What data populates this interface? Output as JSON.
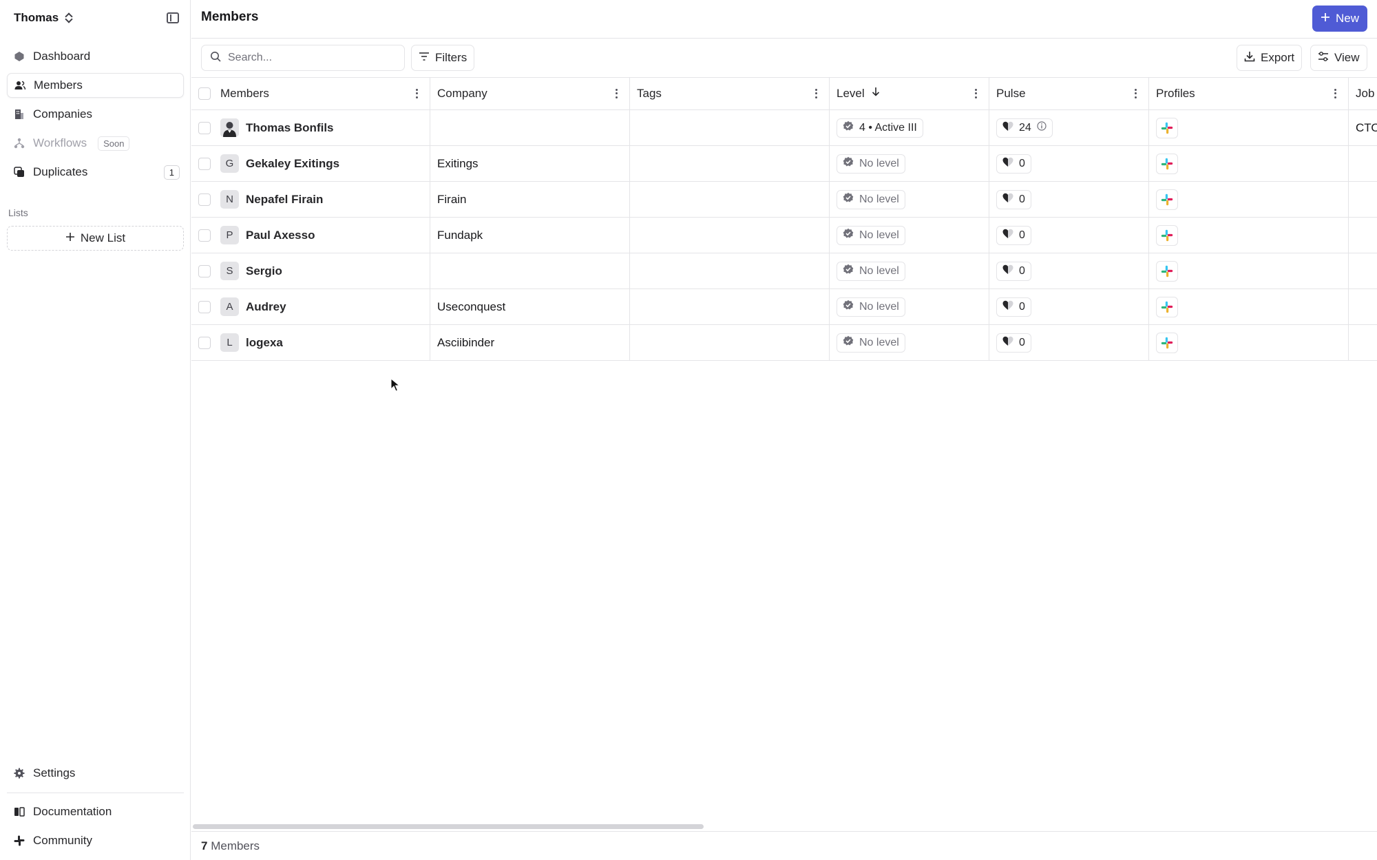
{
  "sidebar": {
    "workspace": "Thomas",
    "nav": [
      {
        "label": "Dashboard",
        "icon": "dashboard-icon"
      },
      {
        "label": "Members",
        "icon": "members-icon",
        "active": true
      },
      {
        "label": "Companies",
        "icon": "building-icon"
      },
      {
        "label": "Workflows",
        "icon": "workflow-icon",
        "badge": "Soon",
        "disabled": true
      },
      {
        "label": "Duplicates",
        "icon": "duplicates-icon",
        "count": "1"
      }
    ],
    "lists_label": "Lists",
    "new_list_label": "New List",
    "bottom": [
      {
        "label": "Settings",
        "icon": "gear-icon"
      },
      {
        "label": "Documentation",
        "icon": "book-icon"
      },
      {
        "label": "Community",
        "icon": "slack-icon"
      }
    ]
  },
  "header": {
    "title": "Members",
    "new_button": "New"
  },
  "toolbar": {
    "search_placeholder": "Search...",
    "filters_label": "Filters",
    "export_label": "Export",
    "view_label": "View"
  },
  "table": {
    "columns": [
      "Members",
      "Company",
      "Tags",
      "Level",
      "Pulse",
      "Profiles",
      "Job"
    ],
    "sorted_column": "Level",
    "rows": [
      {
        "initial": "",
        "photo": true,
        "name": "Thomas Bonfils",
        "company": "",
        "level": "4 • Active III",
        "level_muted": false,
        "pulse": "24",
        "pulse_info": true,
        "job": "CTO"
      },
      {
        "initial": "G",
        "name": "Gekaley Exitings",
        "company": "Exitings",
        "level": "No level",
        "level_muted": true,
        "pulse": "0",
        "job": ""
      },
      {
        "initial": "N",
        "name": "Nepafel Firain",
        "company": "Firain",
        "level": "No level",
        "level_muted": true,
        "pulse": "0",
        "job": ""
      },
      {
        "initial": "P",
        "name": "Paul Axesso",
        "company": "Fundapk",
        "level": "No level",
        "level_muted": true,
        "pulse": "0",
        "job": ""
      },
      {
        "initial": "S",
        "name": "Sergio",
        "company": "",
        "level": "No level",
        "level_muted": true,
        "pulse": "0",
        "job": ""
      },
      {
        "initial": "A",
        "name": "Audrey",
        "company": "Useconquest",
        "level": "No level",
        "level_muted": true,
        "pulse": "0",
        "job": ""
      },
      {
        "initial": "L",
        "name": "logexa",
        "company": "Asciibinder",
        "level": "No level",
        "level_muted": true,
        "pulse": "0",
        "job": ""
      }
    ]
  },
  "footer": {
    "count": "7",
    "label": "Members"
  },
  "colors": {
    "accent": "#4f5bd5",
    "border": "#e4e4e7"
  }
}
